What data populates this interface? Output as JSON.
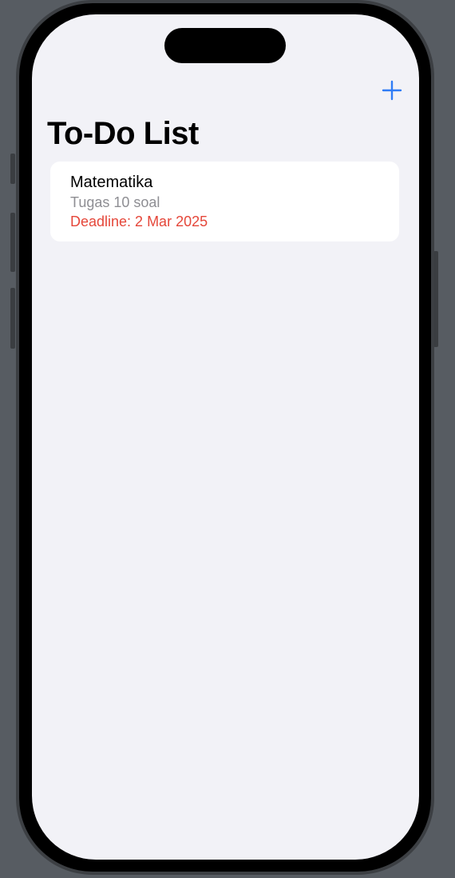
{
  "nav": {
    "title": "To-Do List",
    "add_icon": "plus-icon",
    "accent_color": "#2f7cf6"
  },
  "tasks": [
    {
      "title": "Matematika",
      "description": "Tugas 10 soal",
      "deadline": "Deadline: 2 Mar 2025",
      "deadline_color": "#e5473a"
    }
  ]
}
